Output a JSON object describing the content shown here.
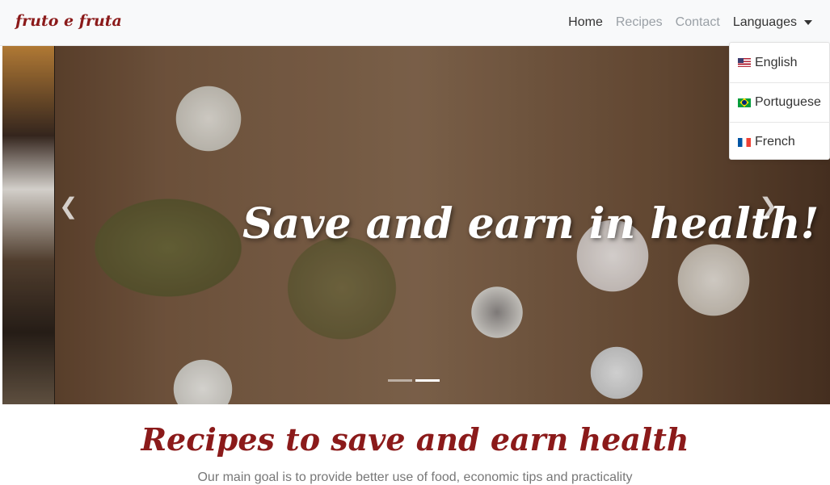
{
  "navbar": {
    "brand": "fruto e fruta",
    "links": [
      {
        "label": "Home"
      },
      {
        "label": "Recipes"
      },
      {
        "label": "Contact"
      }
    ],
    "languages_label": "Languages"
  },
  "languages_menu": [
    {
      "label": "English",
      "flag": "us-flag-icon"
    },
    {
      "label": "Portuguese",
      "flag": "brazil-flag-icon"
    },
    {
      "label": "French",
      "flag": "france-flag-icon"
    }
  ],
  "hero": {
    "title": "Save and earn in health!",
    "prev_icon": "chevron-left-icon",
    "next_icon": "chevron-right-icon",
    "slide_count": 2,
    "active_slide": 2
  },
  "section": {
    "title": "Recipes to save and earn health",
    "subtitle": "Our main goal is to provide better use of food, economic tips and practicality"
  },
  "colors": {
    "brand": "#8b1a1a",
    "nav_bg": "#f8f9fa"
  }
}
